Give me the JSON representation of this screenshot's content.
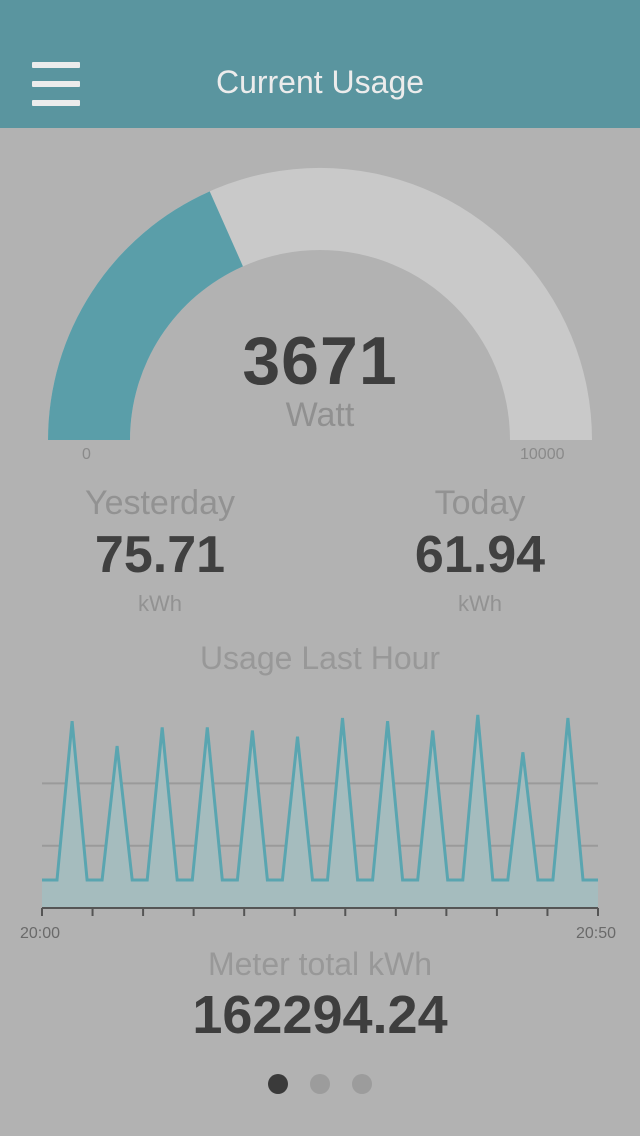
{
  "header": {
    "title": "Current Usage",
    "menu_icon": "hamburger-menu-icon"
  },
  "gauge": {
    "value": "3671",
    "value_number": 3671,
    "unit": "Watt",
    "min": "0",
    "max": "10000",
    "min_number": 0,
    "max_number": 10000,
    "fill_color": "#5a9ea9",
    "track_color": "#c9c9c9"
  },
  "stats": {
    "yesterday": {
      "label": "Yesterday",
      "value": "75.71",
      "unit": "kWh"
    },
    "today": {
      "label": "Today",
      "value": "61.94",
      "unit": "kWh"
    }
  },
  "chart": {
    "title": "Usage Last Hour",
    "x_start": "20:00",
    "x_end": "20:50",
    "line_color": "#5aa5b0",
    "fill_color": "#a5bcbe"
  },
  "chart_data": {
    "type": "line",
    "title": "Usage Last Hour",
    "x_labels": [
      "20:00",
      "20:50"
    ],
    "series": [
      {
        "values": [
          900,
          900,
          6000,
          900,
          900,
          5200,
          900,
          900,
          5800,
          900,
          900,
          5800,
          900,
          900,
          5700,
          900,
          900,
          5500,
          900,
          900,
          6100,
          900,
          900,
          6000,
          900,
          900,
          5700,
          900,
          900,
          6200,
          900,
          900,
          5000,
          900,
          900,
          6100,
          900,
          900
        ]
      }
    ],
    "ylim": [
      0,
      7000
    ],
    "grid_lines": [
      2000,
      4000
    ]
  },
  "meter": {
    "label": "Meter total kWh",
    "value": "162294.24"
  },
  "pager": {
    "pages": 3,
    "active": 0
  }
}
